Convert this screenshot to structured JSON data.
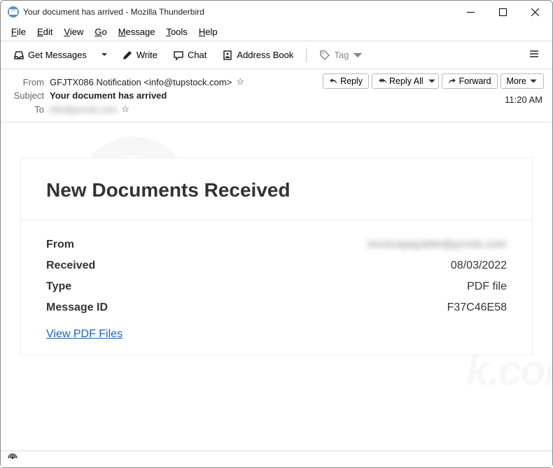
{
  "window": {
    "title": "Your document has arrived - Mozilla Thunderbird"
  },
  "menu": {
    "file": "File",
    "edit": "Edit",
    "view": "View",
    "go": "Go",
    "message": "Message",
    "tools": "Tools",
    "help": "Help"
  },
  "toolbar": {
    "get_messages": "Get Messages",
    "write": "Write",
    "chat": "Chat",
    "address_book": "Address Book",
    "tag": "Tag"
  },
  "headers": {
    "from_label": "From",
    "from_value": "GFJTX086 Notification <info@tupstock.com>",
    "subject_label": "Subject",
    "subject_value": "Your document has arrived",
    "to_label": "To",
    "to_value": "info@pcrisk.com",
    "time": "11:20 AM"
  },
  "actions": {
    "reply": "Reply",
    "reply_all": "Reply All",
    "forward": "Forward",
    "more": "More"
  },
  "email": {
    "heading": "New Documents Received",
    "rows": {
      "from_label": "From",
      "from_value": "invoicepayable@pcrisk.com",
      "received_label": "Received",
      "received_value": "08/03/2022",
      "type_label": "Type",
      "type_value": "PDF file",
      "msgid_label": "Message ID",
      "msgid_value": "F37C46E58"
    },
    "link": "View PDF Files"
  }
}
